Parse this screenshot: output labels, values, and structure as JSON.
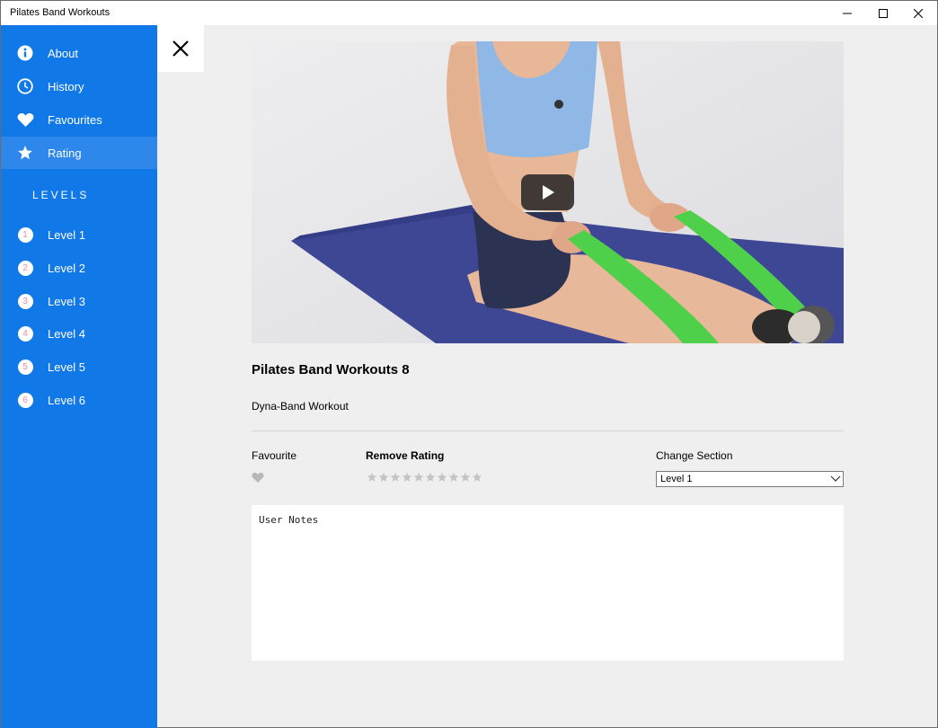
{
  "window": {
    "title": "Pilates Band Workouts",
    "controls": [
      "minimize",
      "maximize",
      "close"
    ]
  },
  "sidebar": {
    "accent_color": "#1178e8",
    "selected_color": "#2e88ec",
    "items": [
      {
        "label": "About",
        "icon": "info-icon"
      },
      {
        "label": "History",
        "icon": "clock-icon"
      },
      {
        "label": "Favourites",
        "icon": "heart-icon"
      },
      {
        "label": "Rating",
        "icon": "star-icon",
        "selected": true
      }
    ],
    "levels_header": "LEVELS",
    "levels": [
      {
        "badge": "1",
        "label": "Level 1"
      },
      {
        "badge": "2",
        "label": "Level 2"
      },
      {
        "badge": "3",
        "label": "Level 3"
      },
      {
        "badge": "4",
        "label": "Level 4"
      },
      {
        "badge": "5",
        "label": "Level 5"
      },
      {
        "badge": "6",
        "label": "Level 6"
      }
    ]
  },
  "detail": {
    "close_icon": "close-x-icon",
    "video_play_icon": "play-icon",
    "title": "Pilates Band Workouts 8",
    "subtitle": "Dyna-Band Workout",
    "favourite_label": "Favourite",
    "rating_label": "Remove Rating",
    "rating_value": 0,
    "rating_max": 10,
    "section_label": "Change Section",
    "section_value": "Level 1",
    "notes_placeholder": "User Notes"
  }
}
